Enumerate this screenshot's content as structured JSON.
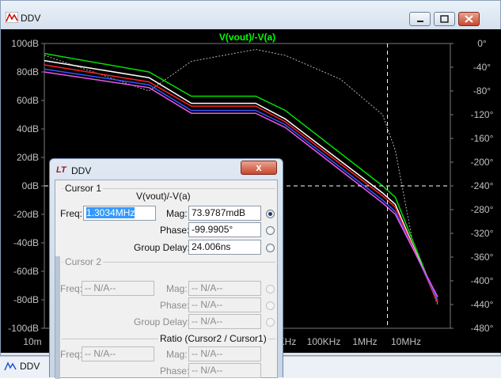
{
  "main_window": {
    "title": "DDV",
    "icon": "waveform-icon",
    "buttons": [
      "minimize-icon",
      "maximize-icon",
      "close-icon"
    ]
  },
  "chart_data": {
    "type": "line",
    "title": "V(vout)/-V(a)",
    "x_scale": "log",
    "x_ticks": [
      "10m",
      "KHz",
      "100KHz",
      "1MHz",
      "10MHz"
    ],
    "y_left_ticks": [
      "100dB",
      "80dB",
      "60dB",
      "40dB",
      "20dB",
      "0dB",
      "-20dB",
      "-40dB",
      "-60dB",
      "-80dB",
      "-100dB"
    ],
    "y_left_range": [
      -100,
      100
    ],
    "y_right_ticks": [
      "0°",
      "-40°",
      "-80°",
      "-120°",
      "-160°",
      "-200°",
      "-240°",
      "-280°",
      "-320°",
      "-360°",
      "-400°",
      "-440°",
      "-480°"
    ],
    "y_right_range": [
      -480,
      0
    ],
    "cursor": {
      "freq_hz": 1303400,
      "db": 0,
      "phase_deg": -240
    },
    "colors": {
      "background": "#000000",
      "grid": "#7a7a7a",
      "title": "#00ff00",
      "axis_text": "#c0c0c0"
    },
    "series": [
      {
        "color": "#00e000",
        "points": [
          [
            0.01,
            93
          ],
          [
            3,
            80
          ],
          [
            30,
            63
          ],
          [
            1000,
            63
          ],
          [
            5000,
            53
          ],
          [
            1000000,
            0
          ],
          [
            2000000,
            -8
          ],
          [
            20000000,
            -82
          ]
        ]
      },
      {
        "color": "#ffffff",
        "points": [
          [
            0.01,
            88
          ],
          [
            3,
            76
          ],
          [
            30,
            58
          ],
          [
            1000,
            58
          ],
          [
            5000,
            47
          ],
          [
            1000000,
            -5
          ],
          [
            2000000,
            -13
          ],
          [
            20000000,
            -82
          ]
        ]
      },
      {
        "color": "#ff2020",
        "points": [
          [
            0.01,
            85
          ],
          [
            3,
            73
          ],
          [
            30,
            56
          ],
          [
            1000,
            56
          ],
          [
            5000,
            45
          ],
          [
            1000000,
            -7
          ],
          [
            2000000,
            -15
          ],
          [
            20000000,
            -82
          ]
        ]
      },
      {
        "color": "#3355ff",
        "points": [
          [
            0.01,
            82
          ],
          [
            3,
            71
          ],
          [
            30,
            53
          ],
          [
            1000,
            53
          ],
          [
            5000,
            43
          ],
          [
            1000000,
            -10
          ],
          [
            2000000,
            -18
          ],
          [
            20000000,
            -80
          ]
        ]
      },
      {
        "color": "#ee55ee",
        "points": [
          [
            0.01,
            80
          ],
          [
            3,
            69
          ],
          [
            30,
            51
          ],
          [
            1000,
            51
          ],
          [
            5000,
            41
          ],
          [
            1000000,
            -12
          ],
          [
            2000000,
            -20
          ],
          [
            20000000,
            -78
          ]
        ]
      }
    ],
    "phase_series": {
      "color": "#b0b0b0",
      "points": [
        [
          0.01,
          -20
        ],
        [
          3,
          -80
        ],
        [
          30,
          -30
        ],
        [
          1000,
          -10
        ],
        [
          5000,
          -20
        ],
        [
          100000,
          -60
        ],
        [
          1000000,
          -120
        ],
        [
          2000000,
          -180
        ],
        [
          5000000,
          -330
        ],
        [
          20000000,
          -440
        ]
      ]
    }
  },
  "dialog": {
    "title": "DDV",
    "logo": "LT",
    "close": "x",
    "cursor1": {
      "group_label": "Cursor 1",
      "expression": "V(vout)/-V(a)",
      "freq_label": "Freq:",
      "freq_value": "1.3034MHz",
      "mag_label": "Mag:",
      "mag_value": "73.9787mdB",
      "phase_label": "Phase:",
      "phase_value": "-99.9905°",
      "group_delay_label": "Group Delay:",
      "group_delay_value": "24.006ns"
    },
    "cursor2": {
      "group_label": "Cursor 2",
      "freq_label": "Freq:",
      "freq_value": "-- N/A--",
      "mag_label": "Mag:",
      "mag_value": "-- N/A--",
      "phase_label": "Phase:",
      "phase_value": "-- N/A--",
      "group_delay_label": "Group Delay:",
      "group_delay_value": "-- N/A--"
    },
    "ratio": {
      "group_label": "Ratio (Cursor2 / Cursor1)",
      "freq_label": "Freq:",
      "freq_value": "-- N/A--",
      "mag_label": "Mag:",
      "mag_value": "-- N/A--",
      "phase_label": "Phase:",
      "phase_value": "-- N/A--"
    }
  },
  "status_bar": {
    "label": "DDV"
  }
}
